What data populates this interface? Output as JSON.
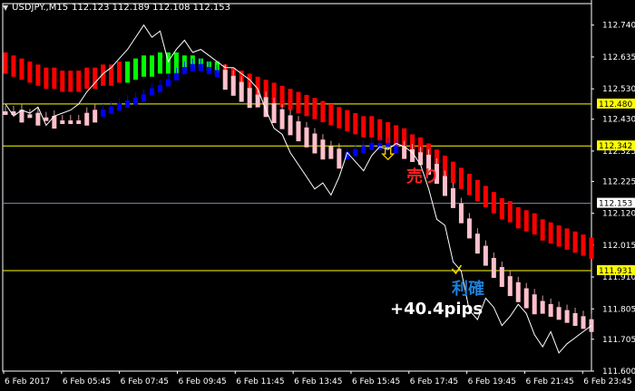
{
  "header": {
    "symbol": "USDJPY.,M15",
    "quote": "112.123 112.189 112.108 112.153"
  },
  "annotations": {
    "sell_label": "売り",
    "profit_take_label": "利確",
    "pips_label": "+40.4pips"
  },
  "colors": {
    "background": "#000000",
    "price_line": "#ffffff",
    "level_line": "#ffff00",
    "current_price_line": "#8a8ab0",
    "cloud_down": "#ff0000",
    "cloud_up": "#00ff00",
    "lower_band_down": "#ffc0cb",
    "lower_band_up": "#0000ff",
    "sell_marker": "#ffd000",
    "profit_marker": "#ffe000"
  },
  "chart_data": {
    "type": "line",
    "title": "",
    "symbol": "USDJPY.",
    "timeframe": "M15",
    "x_tick_labels": [
      "6 Feb 2017",
      "6 Feb 05:45",
      "6 Feb 07:45",
      "6 Feb 09:45",
      "6 Feb 11:45",
      "6 Feb 13:45",
      "6 Feb 15:45",
      "6 Feb 17:45",
      "6 Feb 19:45",
      "6 Feb 21:45",
      "6 Feb 23:45"
    ],
    "y_tick_labels": [
      "112.740",
      "112.635",
      "112.530",
      "112.430",
      "112.325",
      "112.225",
      "112.120",
      "112.015",
      "111.910",
      "111.805",
      "111.705",
      "111.600"
    ],
    "ylim": [
      111.6,
      112.775
    ],
    "grid": false,
    "price_series": [
      112.48,
      112.44,
      112.46,
      112.45,
      112.47,
      112.41,
      112.44,
      112.45,
      112.46,
      112.48,
      112.52,
      112.55,
      112.58,
      112.6,
      112.63,
      112.66,
      112.7,
      112.74,
      112.7,
      112.72,
      112.62,
      112.66,
      112.69,
      112.65,
      112.66,
      112.64,
      112.62,
      112.6,
      112.6,
      112.58,
      112.56,
      112.53,
      112.46,
      112.4,
      112.38,
      112.32,
      112.28,
      112.24,
      112.2,
      112.22,
      112.18,
      112.24,
      112.32,
      112.29,
      112.26,
      112.31,
      112.34,
      112.33,
      112.35,
      112.34,
      112.32,
      112.28,
      112.2,
      112.1,
      112.08,
      111.96,
      111.93,
      111.8,
      111.77,
      111.84,
      111.81,
      111.75,
      111.78,
      111.82,
      111.79,
      111.72,
      111.68,
      111.73,
      111.66,
      111.69,
      111.71,
      111.73,
      111.75
    ],
    "cloud_upper": [
      112.65,
      112.64,
      112.63,
      112.62,
      112.61,
      112.6,
      112.6,
      112.59,
      112.59,
      112.59,
      112.6,
      112.6,
      112.61,
      112.61,
      112.62,
      112.62,
      112.63,
      112.64,
      112.64,
      112.65,
      112.65,
      112.65,
      112.64,
      112.64,
      112.63,
      112.62,
      112.62,
      112.61,
      112.6,
      112.59,
      112.58,
      112.57,
      112.56,
      112.55,
      112.54,
      112.53,
      112.52,
      112.51,
      112.5,
      112.49,
      112.48,
      112.47,
      112.46,
      112.45,
      112.44,
      112.44,
      112.43,
      112.42,
      112.41,
      112.4,
      112.38,
      112.37,
      112.35,
      112.33,
      112.31,
      112.29,
      112.27,
      112.25,
      112.23,
      112.21,
      112.19,
      112.17,
      112.16,
      112.14,
      112.13,
      112.12,
      112.1,
      112.09,
      112.08,
      112.07,
      112.06,
      112.05,
      112.04
    ],
    "cloud_lower": [
      112.45,
      112.45,
      112.44,
      112.44,
      112.43,
      112.43,
      112.42,
      112.42,
      112.42,
      112.42,
      112.43,
      112.44,
      112.45,
      112.46,
      112.47,
      112.48,
      112.49,
      112.5,
      112.52,
      112.53,
      112.55,
      112.57,
      112.59,
      112.6,
      112.6,
      112.59,
      112.58,
      112.56,
      112.54,
      112.52,
      112.5,
      112.49,
      112.47,
      112.45,
      112.43,
      112.41,
      112.39,
      112.37,
      112.35,
      112.33,
      112.32,
      112.3,
      112.31,
      112.32,
      112.33,
      112.34,
      112.34,
      112.34,
      112.33,
      112.32,
      112.31,
      112.3,
      112.28,
      112.25,
      112.21,
      112.17,
      112.12,
      112.07,
      112.02,
      111.98,
      111.94,
      111.91,
      111.88,
      111.86,
      111.84,
      111.82,
      111.81,
      111.8,
      111.79,
      111.78,
      111.77,
      111.76,
      111.75
    ],
    "cloud_trend": [
      "down",
      "down",
      "down",
      "down",
      "down",
      "down",
      "down",
      "down",
      "down",
      "down",
      "down",
      "down",
      "down",
      "down",
      "down",
      "up",
      "up",
      "up",
      "up",
      "up",
      "up",
      "up",
      "up",
      "up",
      "up",
      "up",
      "up",
      "down",
      "down",
      "down",
      "down",
      "down",
      "down",
      "down",
      "down",
      "down",
      "down",
      "down",
      "down",
      "down",
      "down",
      "down",
      "down",
      "down",
      "down",
      "down",
      "down",
      "down",
      "down",
      "down",
      "down",
      "down",
      "down",
      "down",
      "down",
      "down",
      "down",
      "down",
      "down",
      "down",
      "down",
      "down",
      "down",
      "down",
      "down",
      "down",
      "down",
      "down",
      "down",
      "down",
      "down",
      "down",
      "down"
    ],
    "band_trend": [
      "down",
      "down",
      "down",
      "down",
      "down",
      "down",
      "down",
      "down",
      "down",
      "down",
      "down",
      "down",
      "up",
      "up",
      "up",
      "up",
      "up",
      "up",
      "up",
      "up",
      "up",
      "up",
      "up",
      "up",
      "up",
      "up",
      "up",
      "down",
      "down",
      "down",
      "down",
      "down",
      "down",
      "down",
      "down",
      "down",
      "down",
      "down",
      "down",
      "down",
      "down",
      "down",
      "up",
      "up",
      "up",
      "up",
      "up",
      "up",
      "up",
      "down",
      "down",
      "down",
      "down",
      "down",
      "down",
      "down",
      "down",
      "down",
      "down",
      "down",
      "down",
      "down",
      "down",
      "down",
      "down",
      "down",
      "down",
      "down",
      "down",
      "down",
      "down",
      "down",
      "down"
    ],
    "levels": [
      {
        "value": 112.48,
        "label": "112.480",
        "kind": "level"
      },
      {
        "value": 112.342,
        "label": "112.342",
        "kind": "level"
      },
      {
        "value": 112.153,
        "label": "112.153",
        "kind": "current"
      },
      {
        "value": 111.931,
        "label": "111.931",
        "kind": "level"
      }
    ],
    "markers": [
      {
        "type": "sell",
        "index": 47,
        "value": 112.342
      },
      {
        "type": "take-profit",
        "index": 56,
        "value": 111.931
      }
    ]
  }
}
